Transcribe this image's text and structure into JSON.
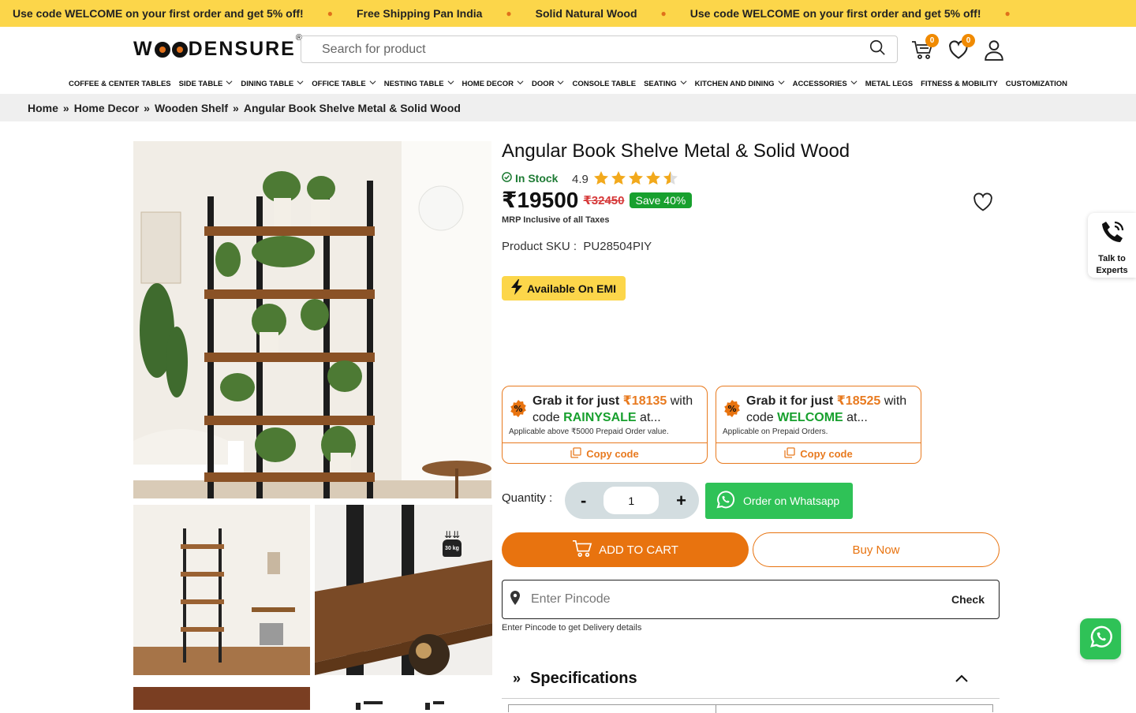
{
  "announcement": {
    "messages": [
      "Use code WELCOME on your first order and get 5% off!",
      "Free Shipping Pan India",
      "Solid Natural Wood",
      "Use code WELCOME on your first order and get 5% off!"
    ]
  },
  "header": {
    "logo_text_1": "W",
    "logo_text_2": "DENSURE",
    "logo_reg": "®",
    "search_placeholder": "Search for product",
    "cart_count": "0",
    "wishlist_count": "0"
  },
  "nav": {
    "items": [
      {
        "label": "COFFEE & CENTER TABLES",
        "dropdown": false
      },
      {
        "label": "SIDE TABLE",
        "dropdown": true
      },
      {
        "label": "DINING TABLE",
        "dropdown": true
      },
      {
        "label": "OFFICE TABLE",
        "dropdown": true
      },
      {
        "label": "NESTING TABLE",
        "dropdown": true
      },
      {
        "label": "HOME DECOR",
        "dropdown": true
      },
      {
        "label": "DOOR",
        "dropdown": true
      },
      {
        "label": "CONSOLE TABLE",
        "dropdown": false
      },
      {
        "label": "SEATING",
        "dropdown": true
      },
      {
        "label": "KITCHEN AND DINING",
        "dropdown": true
      },
      {
        "label": "ACCESSORIES",
        "dropdown": true
      },
      {
        "label": "METAL LEGS",
        "dropdown": false
      },
      {
        "label": "FITNESS & MOBILITY",
        "dropdown": false
      },
      {
        "label": "CUSTOMIZATION",
        "dropdown": false
      }
    ]
  },
  "breadcrumb": {
    "items": [
      "Home",
      "Home Decor",
      "Wooden Shelf",
      "Angular Book Shelve Metal & Solid Wood"
    ],
    "separator": "»"
  },
  "product": {
    "title": "Angular Book Shelve Metal & Solid Wood",
    "stock": "In Stock",
    "rating": "4.9",
    "stars": 4.5,
    "price": "₹19500",
    "mrp": "₹32450",
    "save": "Save 40%",
    "mrp_note": "MRP Inclusive of all Taxes",
    "sku_label": "Product SKU :",
    "sku": "PU28504PIY",
    "emi": "Available On EMI",
    "weight_label": "30 kg"
  },
  "coupons": [
    {
      "prefix": "Grab it for just ",
      "amount": "₹18135",
      "mid": " with code ",
      "code": "RAINYSALE",
      "suffix": " at...",
      "with_word": "with",
      "note": "Applicable above ₹5000 Prepaid Order value.",
      "copy": "Copy code"
    },
    {
      "prefix": "Grab it for just ",
      "amount": "₹18525",
      "mid": " with code ",
      "code": "WELCOME",
      "suffix": " at...",
      "with_word": "with",
      "note": "Applicable on Prepaid Orders.",
      "copy": "Copy code"
    }
  ],
  "purchase": {
    "qty_label": "Quantity :",
    "minus": "-",
    "plus": "+",
    "qty": "1",
    "whatsapp": "Order on Whatsapp",
    "add_to_cart": "ADD TO CART",
    "buy_now": "Buy Now"
  },
  "delivery": {
    "placeholder": "Enter Pincode",
    "check": "Check",
    "note": "Enter Pincode to get Delivery details"
  },
  "specifications": {
    "title": "Specifications",
    "marker": "»"
  },
  "floating": {
    "talk_line1": "Talk to",
    "talk_line2": "Experts"
  },
  "colors": {
    "accent": "#e8730f",
    "announcement_bg": "#fcd64a",
    "success": "#18a02e",
    "whatsapp": "#2fc257"
  }
}
